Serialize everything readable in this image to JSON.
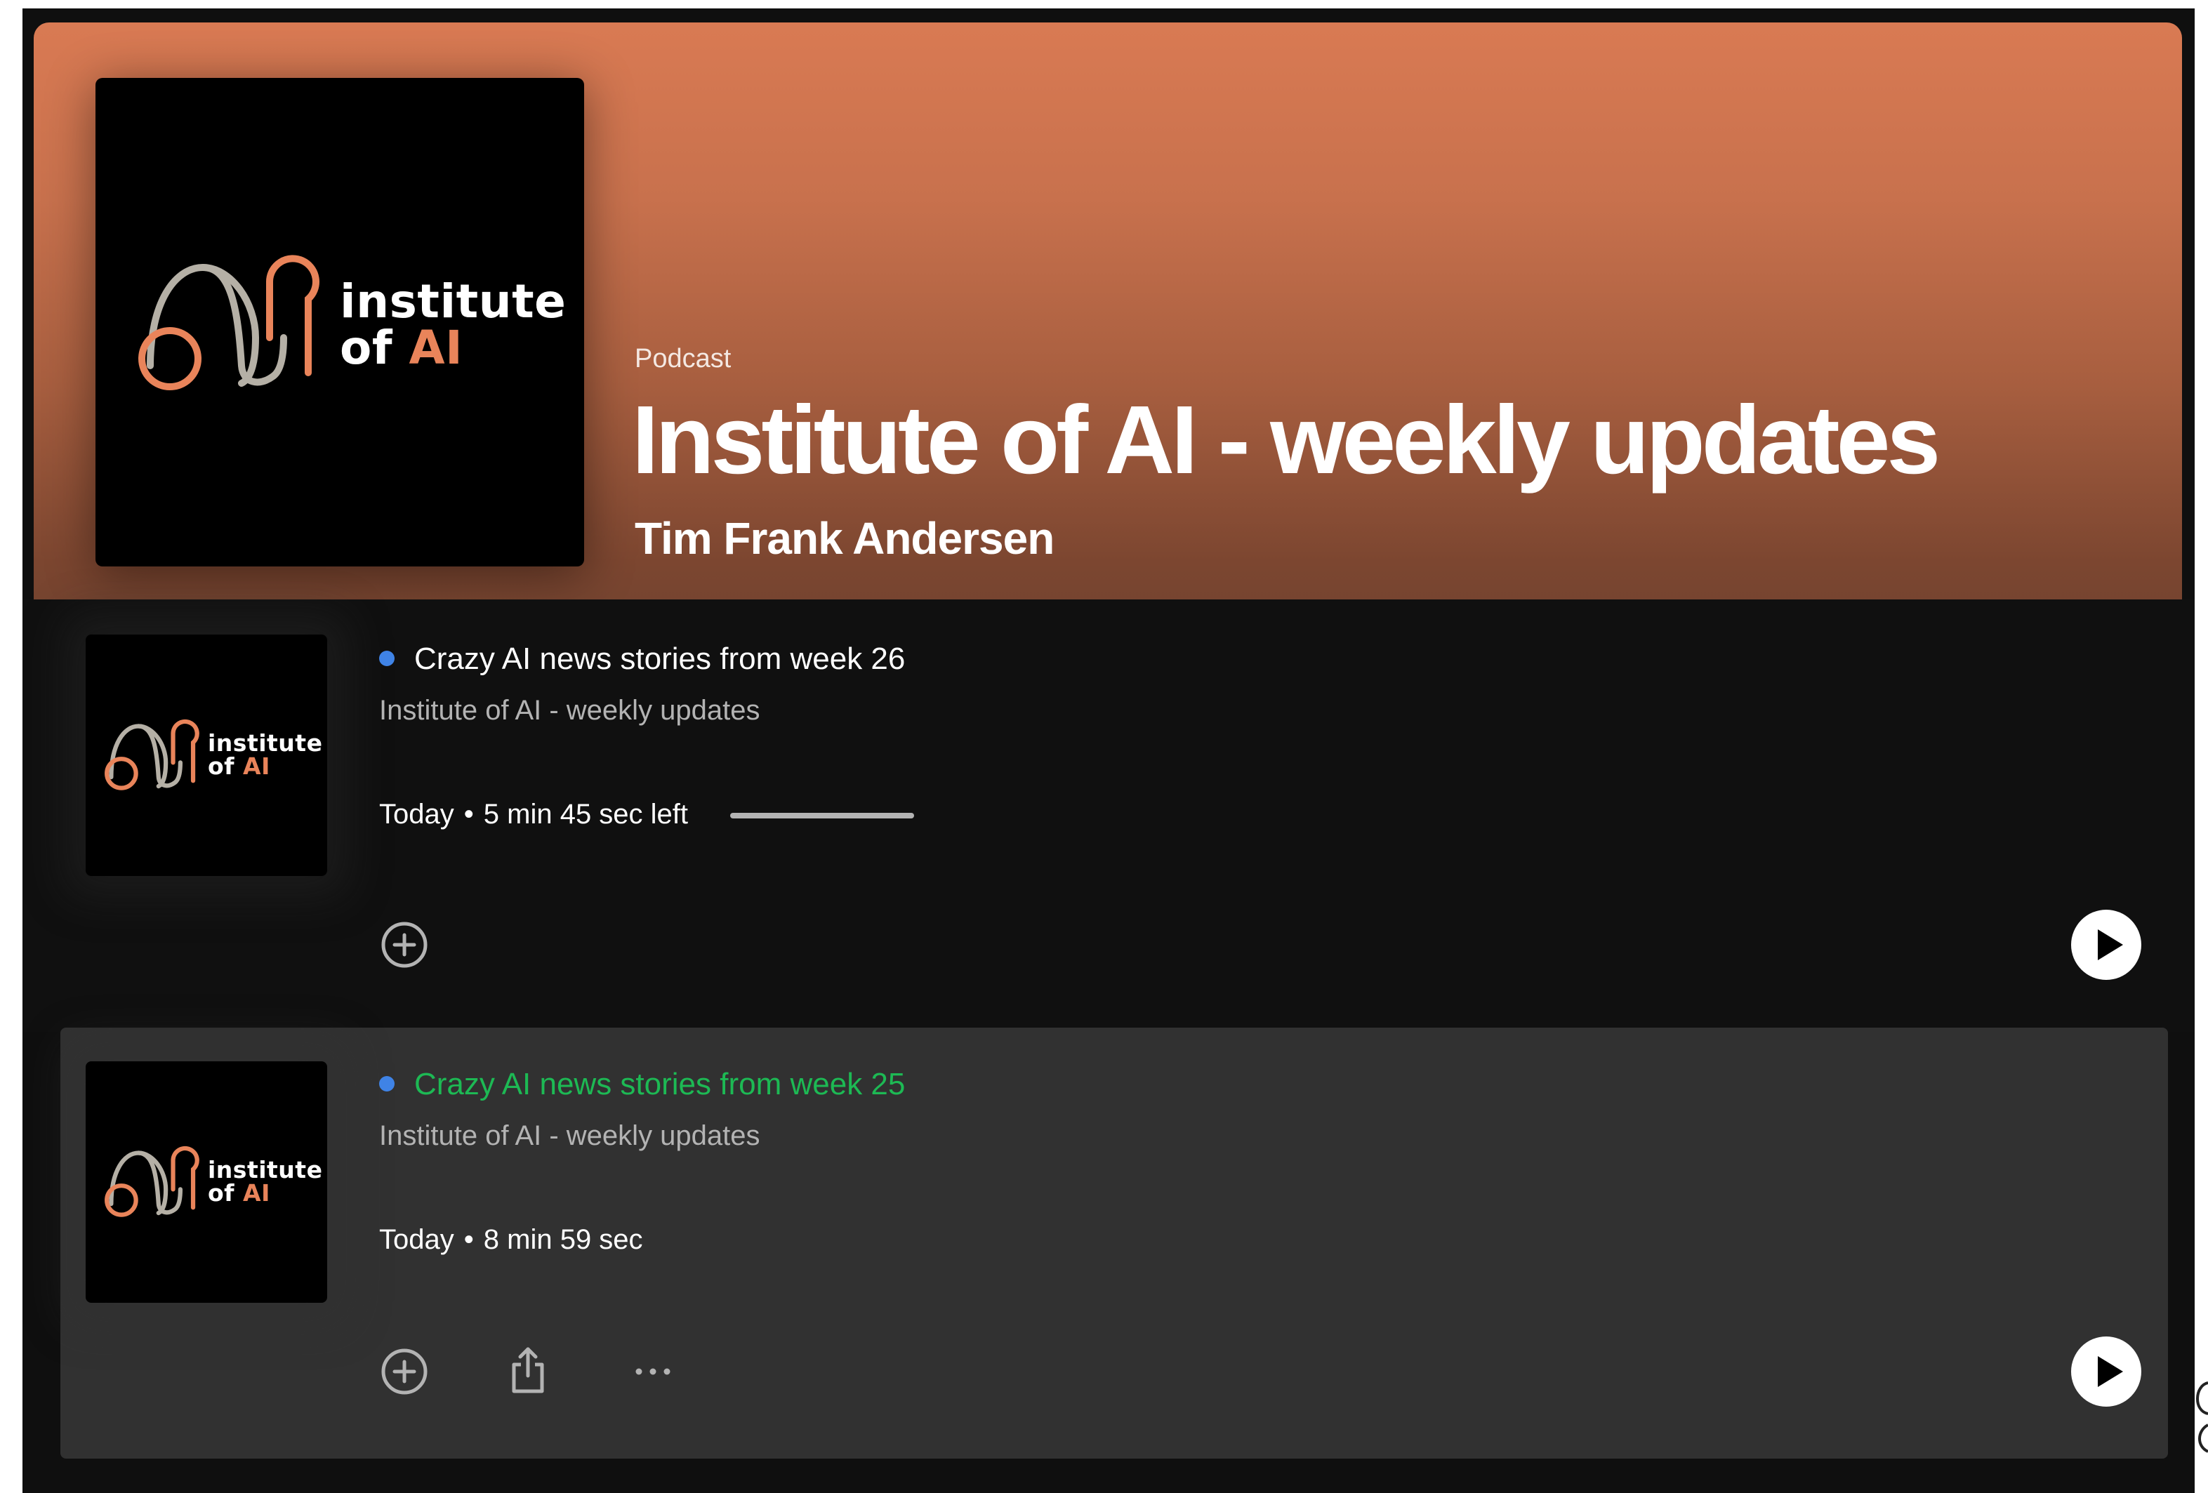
{
  "show": {
    "type_label": "Podcast",
    "title": "Institute of AI - weekly updates",
    "author": "Tim Frank Andersen",
    "logo": {
      "line1": "institute",
      "line2_prefix": "of ",
      "line2_accent": "AI"
    }
  },
  "colors": {
    "header_gradient_top": "#d97a53",
    "header_gradient_bottom": "#754430",
    "accent_orange": "#e9845a",
    "accent_green": "#1db954",
    "unplayed_dot": "#3f83e6",
    "row_background": "#101010",
    "row_hover_background": "#313131"
  },
  "episodes": [
    {
      "title": "Crazy AI news stories from week 26",
      "show": "Institute of AI - weekly updates",
      "date": "Today",
      "duration": "5 min 45 sec left",
      "progress": 1.0,
      "actions": [
        "plus-circle-icon"
      ],
      "play_icon": "play-icon"
    },
    {
      "title": "Crazy AI news stories from week 25",
      "show": "Institute of AI - weekly updates",
      "date": "Today",
      "duration": "8 min 59 sec",
      "actions": [
        "plus-circle-icon",
        "share-icon",
        "more-icon"
      ],
      "play_icon": "play-icon"
    }
  ],
  "meta_separator": "•"
}
